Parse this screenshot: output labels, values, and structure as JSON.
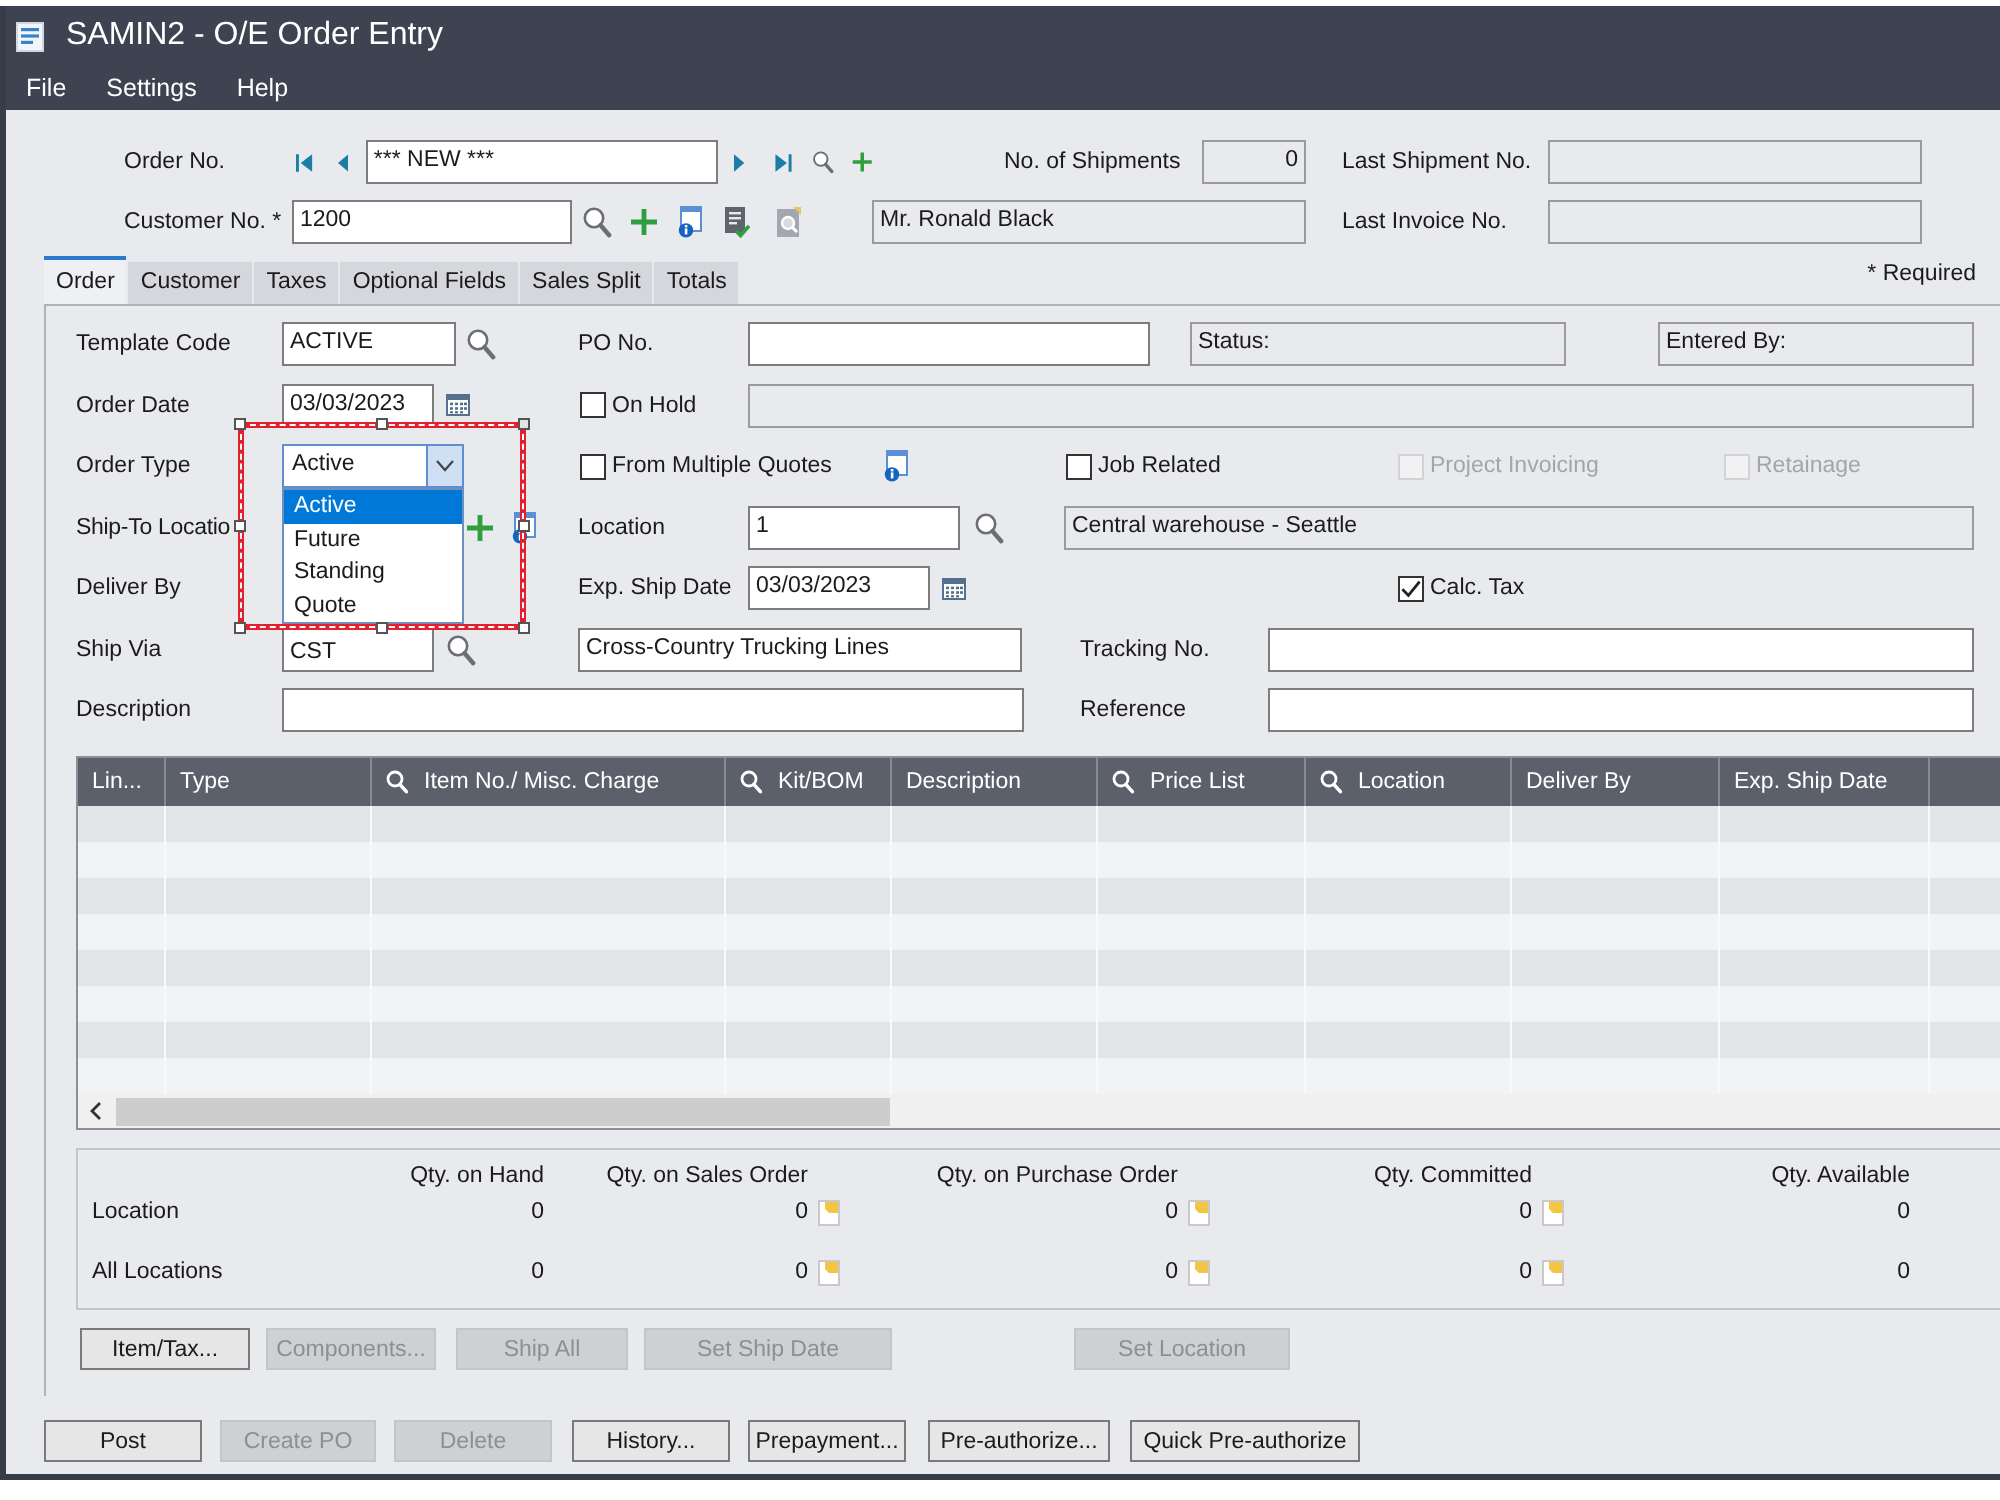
{
  "window": {
    "title": "SAMIN2 - O/E Order Entry"
  },
  "menu": [
    "File",
    "Settings",
    "Help"
  ],
  "header": {
    "order_no": {
      "label": "Order No.",
      "value": "*** NEW ***"
    },
    "no_of_shipments": {
      "label": "No. of Shipments",
      "value": "0"
    },
    "last_shipment_no": {
      "label": "Last Shipment No."
    },
    "customer_no": {
      "label": "Customer No. *",
      "value": "1200"
    },
    "customer_name": {
      "value": "Mr. Ronald Black"
    },
    "last_invoice_no": {
      "label": "Last Invoice No."
    }
  },
  "tabs": [
    {
      "label": "Order",
      "selected": true
    },
    {
      "label": "Customer",
      "selected": false
    },
    {
      "label": "Taxes",
      "selected": false
    },
    {
      "label": "Optional Fields",
      "selected": false
    },
    {
      "label": "Sales Split",
      "selected": false
    },
    {
      "label": "Totals",
      "selected": false
    }
  ],
  "required_note": "* Required",
  "order": {
    "template_code": {
      "label": "Template Code",
      "value": "ACTIVE"
    },
    "po_no": {
      "label": "PO No."
    },
    "status": {
      "text": "Status:"
    },
    "entered_by": {
      "text": "Entered By:"
    },
    "order_date": {
      "label": "Order Date",
      "value": "03/03/2023"
    },
    "on_hold": {
      "label": "On Hold",
      "checked": false,
      "disabled": false
    },
    "order_type": {
      "label": "Order Type",
      "value": "Active",
      "expanded": true,
      "highlighted": true,
      "options": [
        {
          "label": "Active",
          "selected": true
        },
        {
          "label": "Future",
          "selected": false
        },
        {
          "label": "Standing",
          "selected": false
        },
        {
          "label": "Quote",
          "selected": false
        }
      ]
    },
    "from_multiple_quotes": {
      "label": "From Multiple Quotes",
      "checked": false,
      "disabled": false
    },
    "job_related": {
      "label": "Job Related",
      "checked": false,
      "disabled": false
    },
    "project_invoicing": {
      "label": "Project Invoicing",
      "checked": false,
      "disabled": true
    },
    "retainage": {
      "label": "Retainage",
      "checked": false,
      "disabled": true
    },
    "ship_to_location": {
      "label": "Ship-To Locatio"
    },
    "location": {
      "label": "Location",
      "value": "1",
      "description": "Central warehouse - Seattle"
    },
    "deliver_by": {
      "label": "Deliver By"
    },
    "exp_ship_date": {
      "label": "Exp. Ship Date",
      "value": "03/03/2023"
    },
    "calc_tax": {
      "label": "Calc. Tax",
      "checked": true,
      "disabled": false
    },
    "ship_via": {
      "label": "Ship Via",
      "value": "CST",
      "description": "Cross-Country Trucking Lines"
    },
    "tracking_no": {
      "label": "Tracking No."
    },
    "description": {
      "label": "Description"
    },
    "reference": {
      "label": "Reference"
    }
  },
  "grid": {
    "columns": [
      {
        "label": "Lin...",
        "kind": "plain"
      },
      {
        "label": "Type",
        "kind": "plain"
      },
      {
        "label": "Item No./ Misc. Charge",
        "kind": "lookup"
      },
      {
        "label": "Kit/BOM",
        "kind": "lookup"
      },
      {
        "label": "Description",
        "kind": "plain"
      },
      {
        "label": "Price List",
        "kind": "lookup"
      },
      {
        "label": "Location",
        "kind": "lookup"
      },
      {
        "label": "Deliver By",
        "kind": "plain"
      },
      {
        "label": "Exp. Ship Date",
        "kind": "plain"
      }
    ]
  },
  "quantities": {
    "columns": [
      {
        "label": "Qty. on Hand",
        "kind": "plain"
      },
      {
        "label": "Qty. on Sales Order",
        "kind": "with-note"
      },
      {
        "label": "Qty. on Purchase Order",
        "kind": "with-note"
      },
      {
        "label": "Qty. Committed",
        "kind": "with-note"
      },
      {
        "label": "Qty. Available",
        "kind": "plain"
      }
    ],
    "rows": [
      {
        "label": "Location",
        "values": [
          "0",
          "0",
          "0",
          "0",
          "0"
        ]
      },
      {
        "label": "All Locations",
        "values": [
          "0",
          "0",
          "0",
          "0",
          "0"
        ]
      }
    ]
  },
  "line_buttons": [
    {
      "label": "Item/Tax...",
      "disabled": false
    },
    {
      "label": "Components...",
      "disabled": true
    },
    {
      "label": "Ship All",
      "disabled": true
    },
    {
      "label": "Set Ship Date",
      "disabled": true
    },
    {
      "label": "Set Location",
      "disabled": true
    }
  ],
  "actions": [
    {
      "label": "Post",
      "disabled": false
    },
    {
      "label": "Create PO",
      "disabled": true
    },
    {
      "label": "Delete",
      "disabled": true
    },
    {
      "label": "History...",
      "disabled": false
    },
    {
      "label": "Prepayment...",
      "disabled": false
    },
    {
      "label": "Pre-authorize...",
      "disabled": false
    },
    {
      "label": "Quick Pre-authorize",
      "disabled": false
    }
  ]
}
